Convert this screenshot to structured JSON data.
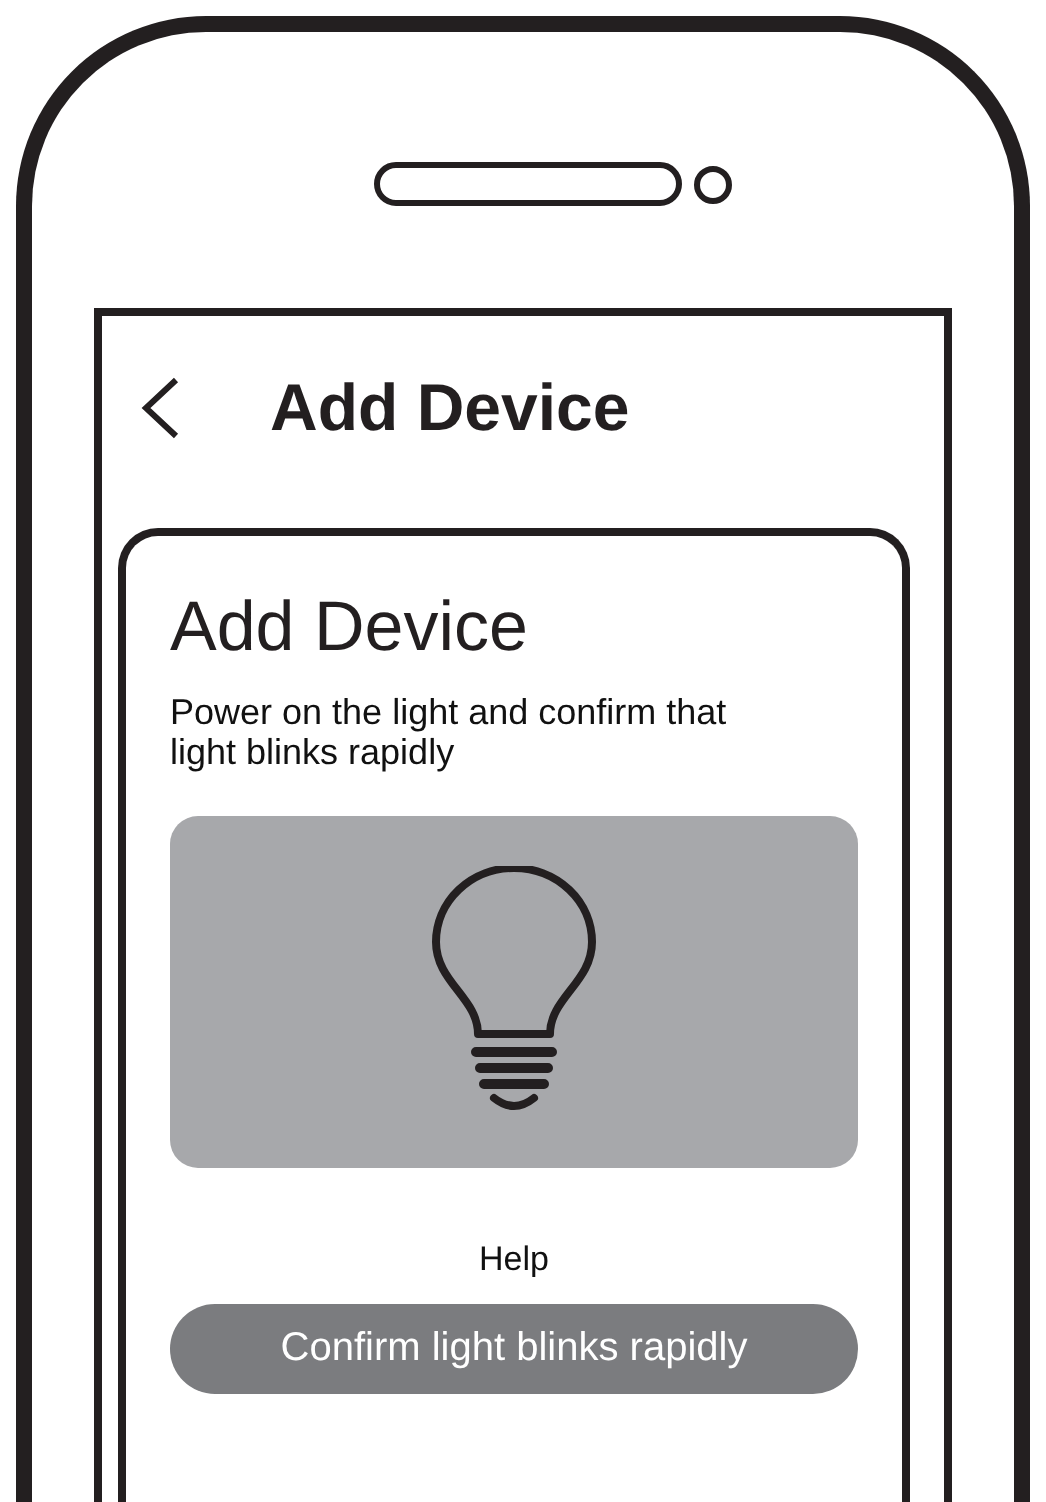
{
  "header": {
    "title": "Add Device"
  },
  "card": {
    "title": "Add Device",
    "instruction": "Power on the light and confirm that light blinks rapidly",
    "help_link": "Help",
    "confirm_button": "Confirm light blinks rapidly"
  }
}
